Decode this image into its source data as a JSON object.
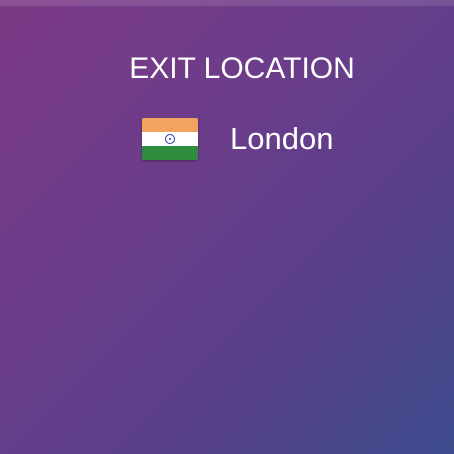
{
  "exit_location": {
    "heading": "EXIT LOCATION",
    "flag_icon": "india-flag-icon",
    "city": "London"
  },
  "colors": {
    "background_start": "#7d3a86",
    "background_end": "#3d4c8c",
    "text": "#ffffff"
  }
}
